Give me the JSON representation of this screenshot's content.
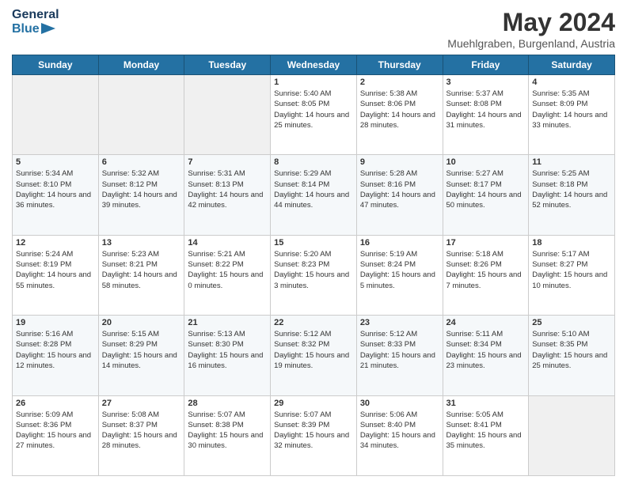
{
  "header": {
    "logo_line1": "General",
    "logo_line2": "Blue",
    "title": "May 2024",
    "subtitle": "Muehlgraben, Burgenland, Austria"
  },
  "columns": [
    "Sunday",
    "Monday",
    "Tuesday",
    "Wednesday",
    "Thursday",
    "Friday",
    "Saturday"
  ],
  "weeks": [
    [
      {
        "day": "",
        "info": ""
      },
      {
        "day": "",
        "info": ""
      },
      {
        "day": "",
        "info": ""
      },
      {
        "day": "1",
        "info": "Sunrise: 5:40 AM\nSunset: 8:05 PM\nDaylight: 14 hours and 25 minutes."
      },
      {
        "day": "2",
        "info": "Sunrise: 5:38 AM\nSunset: 8:06 PM\nDaylight: 14 hours and 28 minutes."
      },
      {
        "day": "3",
        "info": "Sunrise: 5:37 AM\nSunset: 8:08 PM\nDaylight: 14 hours and 31 minutes."
      },
      {
        "day": "4",
        "info": "Sunrise: 5:35 AM\nSunset: 8:09 PM\nDaylight: 14 hours and 33 minutes."
      }
    ],
    [
      {
        "day": "5",
        "info": "Sunrise: 5:34 AM\nSunset: 8:10 PM\nDaylight: 14 hours and 36 minutes."
      },
      {
        "day": "6",
        "info": "Sunrise: 5:32 AM\nSunset: 8:12 PM\nDaylight: 14 hours and 39 minutes."
      },
      {
        "day": "7",
        "info": "Sunrise: 5:31 AM\nSunset: 8:13 PM\nDaylight: 14 hours and 42 minutes."
      },
      {
        "day": "8",
        "info": "Sunrise: 5:29 AM\nSunset: 8:14 PM\nDaylight: 14 hours and 44 minutes."
      },
      {
        "day": "9",
        "info": "Sunrise: 5:28 AM\nSunset: 8:16 PM\nDaylight: 14 hours and 47 minutes."
      },
      {
        "day": "10",
        "info": "Sunrise: 5:27 AM\nSunset: 8:17 PM\nDaylight: 14 hours and 50 minutes."
      },
      {
        "day": "11",
        "info": "Sunrise: 5:25 AM\nSunset: 8:18 PM\nDaylight: 14 hours and 52 minutes."
      }
    ],
    [
      {
        "day": "12",
        "info": "Sunrise: 5:24 AM\nSunset: 8:19 PM\nDaylight: 14 hours and 55 minutes."
      },
      {
        "day": "13",
        "info": "Sunrise: 5:23 AM\nSunset: 8:21 PM\nDaylight: 14 hours and 58 minutes."
      },
      {
        "day": "14",
        "info": "Sunrise: 5:21 AM\nSunset: 8:22 PM\nDaylight: 15 hours and 0 minutes."
      },
      {
        "day": "15",
        "info": "Sunrise: 5:20 AM\nSunset: 8:23 PM\nDaylight: 15 hours and 3 minutes."
      },
      {
        "day": "16",
        "info": "Sunrise: 5:19 AM\nSunset: 8:24 PM\nDaylight: 15 hours and 5 minutes."
      },
      {
        "day": "17",
        "info": "Sunrise: 5:18 AM\nSunset: 8:26 PM\nDaylight: 15 hours and 7 minutes."
      },
      {
        "day": "18",
        "info": "Sunrise: 5:17 AM\nSunset: 8:27 PM\nDaylight: 15 hours and 10 minutes."
      }
    ],
    [
      {
        "day": "19",
        "info": "Sunrise: 5:16 AM\nSunset: 8:28 PM\nDaylight: 15 hours and 12 minutes."
      },
      {
        "day": "20",
        "info": "Sunrise: 5:15 AM\nSunset: 8:29 PM\nDaylight: 15 hours and 14 minutes."
      },
      {
        "day": "21",
        "info": "Sunrise: 5:13 AM\nSunset: 8:30 PM\nDaylight: 15 hours and 16 minutes."
      },
      {
        "day": "22",
        "info": "Sunrise: 5:12 AM\nSunset: 8:32 PM\nDaylight: 15 hours and 19 minutes."
      },
      {
        "day": "23",
        "info": "Sunrise: 5:12 AM\nSunset: 8:33 PM\nDaylight: 15 hours and 21 minutes."
      },
      {
        "day": "24",
        "info": "Sunrise: 5:11 AM\nSunset: 8:34 PM\nDaylight: 15 hours and 23 minutes."
      },
      {
        "day": "25",
        "info": "Sunrise: 5:10 AM\nSunset: 8:35 PM\nDaylight: 15 hours and 25 minutes."
      }
    ],
    [
      {
        "day": "26",
        "info": "Sunrise: 5:09 AM\nSunset: 8:36 PM\nDaylight: 15 hours and 27 minutes."
      },
      {
        "day": "27",
        "info": "Sunrise: 5:08 AM\nSunset: 8:37 PM\nDaylight: 15 hours and 28 minutes."
      },
      {
        "day": "28",
        "info": "Sunrise: 5:07 AM\nSunset: 8:38 PM\nDaylight: 15 hours and 30 minutes."
      },
      {
        "day": "29",
        "info": "Sunrise: 5:07 AM\nSunset: 8:39 PM\nDaylight: 15 hours and 32 minutes."
      },
      {
        "day": "30",
        "info": "Sunrise: 5:06 AM\nSunset: 8:40 PM\nDaylight: 15 hours and 34 minutes."
      },
      {
        "day": "31",
        "info": "Sunrise: 5:05 AM\nSunset: 8:41 PM\nDaylight: 15 hours and 35 minutes."
      },
      {
        "day": "",
        "info": ""
      }
    ]
  ]
}
